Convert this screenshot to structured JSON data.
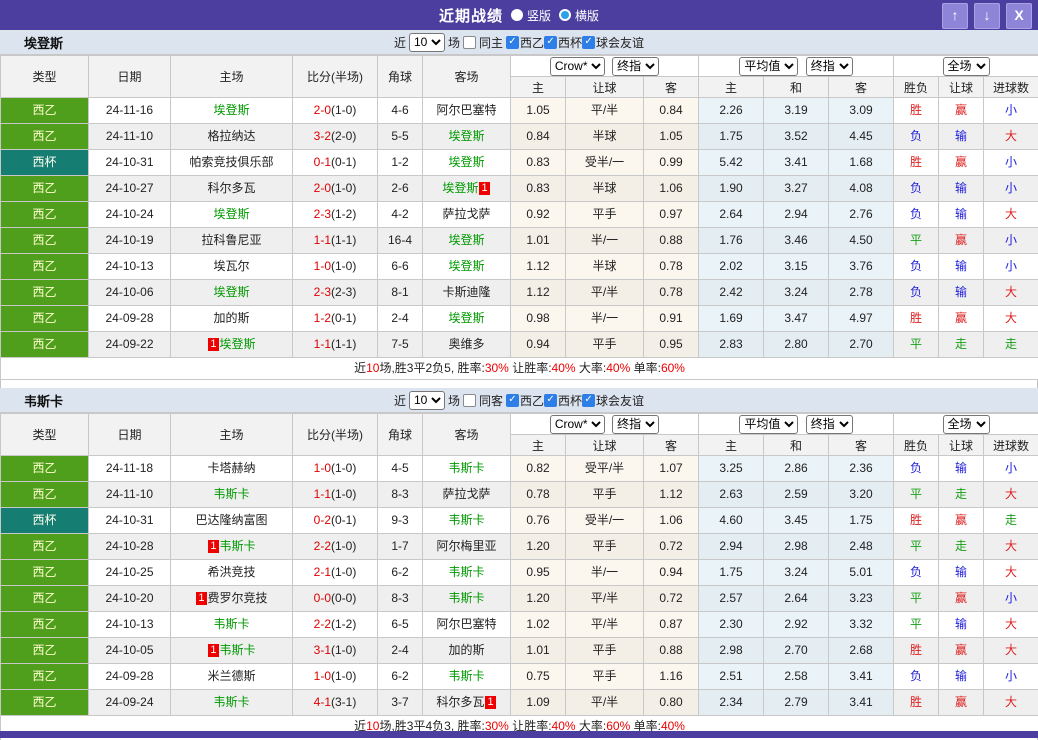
{
  "titlebar": {
    "title": "近期战绩",
    "radios": [
      {
        "label": "竖版",
        "selected": false
      },
      {
        "label": "横版",
        "selected": true
      }
    ],
    "window_buttons": [
      {
        "name": "move-up-button",
        "glyph": "↑"
      },
      {
        "name": "move-down-button",
        "glyph": "↓"
      },
      {
        "name": "close-button",
        "glyph": "X"
      }
    ]
  },
  "colors": {
    "titlebar_purple": "#4c3e9e",
    "league_green": "#4f9e1c",
    "cup_teal": "#157d72",
    "focus_team_green": "#009900",
    "score_red": "#e00000",
    "win_red": "#dd2020",
    "lose_blue": "#2020dd",
    "draw_green": "#18a018",
    "checkbox_blue": "#2d7ee6"
  },
  "columns": {
    "left": [
      "类型",
      "日期",
      "主场",
      "比分(半场)",
      "角球",
      "客场"
    ],
    "asia_selects": [
      "Crow*",
      "终指"
    ],
    "asia_sub": [
      "主",
      "让球",
      "客"
    ],
    "europe_selects": [
      "平均值",
      "终指"
    ],
    "europe_sub": [
      "主",
      "和",
      "客"
    ],
    "result_select": "全场",
    "result_sub": [
      "胜负",
      "让球",
      "进球数"
    ]
  },
  "filter_labels": {
    "near": "近",
    "matches": "10",
    "games": "场",
    "leagues": [
      "西乙",
      "西杯",
      "球会友谊"
    ]
  },
  "teams": [
    {
      "name": "埃登斯",
      "same_label": "同主",
      "same_checked": false,
      "rows": [
        {
          "type": "西乙",
          "date": "24-11-16",
          "home": {
            "name": "埃登斯",
            "focus": true
          },
          "score": "2-0",
          "half": "1-0",
          "corner": "4-6",
          "away": {
            "name": "阿尔巴塞特",
            "focus": false
          },
          "asia": [
            "1.05",
            "平/半",
            "0.84"
          ],
          "europe": [
            "2.26",
            "3.19",
            "3.09"
          ],
          "result": [
            "胜",
            "赢",
            "小"
          ]
        },
        {
          "type": "西乙",
          "date": "24-11-10",
          "home": {
            "name": "格拉纳达",
            "focus": false
          },
          "score": "3-2",
          "half": "2-0",
          "corner": "5-5",
          "away": {
            "name": "埃登斯",
            "focus": true
          },
          "asia": [
            "0.84",
            "半球",
            "1.05"
          ],
          "europe": [
            "1.75",
            "3.52",
            "4.45"
          ],
          "result": [
            "负",
            "输",
            "大"
          ]
        },
        {
          "type": "西杯",
          "date": "24-10-31",
          "home": {
            "name": "帕索竞技俱乐部",
            "focus": false
          },
          "score": "0-1",
          "half": "0-1",
          "corner": "1-2",
          "away": {
            "name": "埃登斯",
            "focus": true
          },
          "asia": [
            "0.83",
            "受半/一",
            "0.99"
          ],
          "europe": [
            "5.42",
            "3.41",
            "1.68"
          ],
          "result": [
            "胜",
            "赢",
            "小"
          ]
        },
        {
          "type": "西乙",
          "date": "24-10-27",
          "home": {
            "name": "科尔多瓦",
            "focus": false
          },
          "score": "2-0",
          "half": "1-0",
          "corner": "2-6",
          "away": {
            "name": "埃登斯",
            "focus": true,
            "badge": "right",
            "badge_text": "1"
          },
          "asia": [
            "0.83",
            "半球",
            "1.06"
          ],
          "europe": [
            "1.90",
            "3.27",
            "4.08"
          ],
          "result": [
            "负",
            "输",
            "小"
          ]
        },
        {
          "type": "西乙",
          "date": "24-10-24",
          "home": {
            "name": "埃登斯",
            "focus": true
          },
          "score": "2-3",
          "half": "1-2",
          "corner": "4-2",
          "away": {
            "name": "萨拉戈萨",
            "focus": false
          },
          "asia": [
            "0.92",
            "平手",
            "0.97"
          ],
          "europe": [
            "2.64",
            "2.94",
            "2.76"
          ],
          "result": [
            "负",
            "输",
            "大"
          ]
        },
        {
          "type": "西乙",
          "date": "24-10-19",
          "home": {
            "name": "拉科鲁尼亚",
            "focus": false
          },
          "score": "1-1",
          "half": "1-1",
          "corner": "16-4",
          "away": {
            "name": "埃登斯",
            "focus": true
          },
          "asia": [
            "1.01",
            "半/一",
            "0.88"
          ],
          "europe": [
            "1.76",
            "3.46",
            "4.50"
          ],
          "result": [
            "平",
            "赢",
            "小"
          ]
        },
        {
          "type": "西乙",
          "date": "24-10-13",
          "home": {
            "name": "埃瓦尔",
            "focus": false
          },
          "score": "1-0",
          "half": "1-0",
          "corner": "6-6",
          "away": {
            "name": "埃登斯",
            "focus": true
          },
          "asia": [
            "1.12",
            "半球",
            "0.78"
          ],
          "europe": [
            "2.02",
            "3.15",
            "3.76"
          ],
          "result": [
            "负",
            "输",
            "小"
          ]
        },
        {
          "type": "西乙",
          "date": "24-10-06",
          "home": {
            "name": "埃登斯",
            "focus": true
          },
          "score": "2-3",
          "half": "2-3",
          "corner": "8-1",
          "away": {
            "name": "卡斯迪隆",
            "focus": false
          },
          "asia": [
            "1.12",
            "平/半",
            "0.78"
          ],
          "europe": [
            "2.42",
            "3.24",
            "2.78"
          ],
          "result": [
            "负",
            "输",
            "大"
          ]
        },
        {
          "type": "西乙",
          "date": "24-09-28",
          "home": {
            "name": "加的斯",
            "focus": false
          },
          "score": "1-2",
          "half": "0-1",
          "corner": "2-4",
          "away": {
            "name": "埃登斯",
            "focus": true
          },
          "asia": [
            "0.98",
            "半/一",
            "0.91"
          ],
          "europe": [
            "1.69",
            "3.47",
            "4.97"
          ],
          "result": [
            "胜",
            "赢",
            "大"
          ]
        },
        {
          "type": "西乙",
          "date": "24-09-22",
          "home": {
            "name": "埃登斯",
            "focus": true,
            "badge": "left",
            "badge_text": "1"
          },
          "score": "1-1",
          "half": "1-1",
          "corner": "7-5",
          "away": {
            "name": "奥维多",
            "focus": false
          },
          "asia": [
            "0.94",
            "平手",
            "0.95"
          ],
          "europe": [
            "2.83",
            "2.80",
            "2.70"
          ],
          "result": [
            "平",
            "走",
            "走"
          ]
        }
      ],
      "summary": [
        {
          "text": "近",
          "red": false
        },
        {
          "text": "10",
          "red": true
        },
        {
          "text": "场,胜3平2负5, 胜率:",
          "red": false
        },
        {
          "text": "30%",
          "red": true
        },
        {
          "text": " 让胜率:",
          "red": false
        },
        {
          "text": "40%",
          "red": true
        },
        {
          "text": " 大率:",
          "red": false
        },
        {
          "text": "40%",
          "red": true
        },
        {
          "text": " 单率:",
          "red": false
        },
        {
          "text": "60%",
          "red": true
        }
      ]
    },
    {
      "name": "韦斯卡",
      "same_label": "同客",
      "same_checked": false,
      "rows": [
        {
          "type": "西乙",
          "date": "24-11-18",
          "home": {
            "name": "卡塔赫纳",
            "focus": false
          },
          "score": "1-0",
          "half": "1-0",
          "corner": "4-5",
          "away": {
            "name": "韦斯卡",
            "focus": true
          },
          "asia": [
            "0.82",
            "受平/半",
            "1.07"
          ],
          "europe": [
            "3.25",
            "2.86",
            "2.36"
          ],
          "result": [
            "负",
            "输",
            "小"
          ]
        },
        {
          "type": "西乙",
          "date": "24-11-10",
          "home": {
            "name": "韦斯卡",
            "focus": true
          },
          "score": "1-1",
          "half": "1-0",
          "corner": "8-3",
          "away": {
            "name": "萨拉戈萨",
            "focus": false
          },
          "asia": [
            "0.78",
            "平手",
            "1.12"
          ],
          "europe": [
            "2.63",
            "2.59",
            "3.20"
          ],
          "result": [
            "平",
            "走",
            "大"
          ]
        },
        {
          "type": "西杯",
          "date": "24-10-31",
          "home": {
            "name": "巴达隆纳富图",
            "focus": false
          },
          "score": "0-2",
          "half": "0-1",
          "corner": "9-3",
          "away": {
            "name": "韦斯卡",
            "focus": true
          },
          "asia": [
            "0.76",
            "受半/一",
            "1.06"
          ],
          "europe": [
            "4.60",
            "3.45",
            "1.75"
          ],
          "result": [
            "胜",
            "赢",
            "走"
          ]
        },
        {
          "type": "西乙",
          "date": "24-10-28",
          "home": {
            "name": "韦斯卡",
            "focus": true,
            "badge": "left",
            "badge_text": "1"
          },
          "score": "2-2",
          "half": "1-0",
          "corner": "1-7",
          "away": {
            "name": "阿尔梅里亚",
            "focus": false
          },
          "asia": [
            "1.20",
            "平手",
            "0.72"
          ],
          "europe": [
            "2.94",
            "2.98",
            "2.48"
          ],
          "result": [
            "平",
            "走",
            "大"
          ]
        },
        {
          "type": "西乙",
          "date": "24-10-25",
          "home": {
            "name": "希洪竞技",
            "focus": false
          },
          "score": "2-1",
          "half": "1-0",
          "corner": "6-2",
          "away": {
            "name": "韦斯卡",
            "focus": true
          },
          "asia": [
            "0.95",
            "半/一",
            "0.94"
          ],
          "europe": [
            "1.75",
            "3.24",
            "5.01"
          ],
          "result": [
            "负",
            "输",
            "大"
          ]
        },
        {
          "type": "西乙",
          "date": "24-10-20",
          "home": {
            "name": "费罗尔竞技",
            "focus": false,
            "badge": "left",
            "badge_text": "1"
          },
          "score": "0-0",
          "half": "0-0",
          "corner": "8-3",
          "away": {
            "name": "韦斯卡",
            "focus": true
          },
          "asia": [
            "1.20",
            "平/半",
            "0.72"
          ],
          "europe": [
            "2.57",
            "2.64",
            "3.23"
          ],
          "result": [
            "平",
            "赢",
            "小"
          ]
        },
        {
          "type": "西乙",
          "date": "24-10-13",
          "home": {
            "name": "韦斯卡",
            "focus": true
          },
          "score": "2-2",
          "half": "1-2",
          "corner": "6-5",
          "away": {
            "name": "阿尔巴塞特",
            "focus": false
          },
          "asia": [
            "1.02",
            "平/半",
            "0.87"
          ],
          "europe": [
            "2.30",
            "2.92",
            "3.32"
          ],
          "result": [
            "平",
            "输",
            "大"
          ]
        },
        {
          "type": "西乙",
          "date": "24-10-05",
          "home": {
            "name": "韦斯卡",
            "focus": true,
            "badge": "left",
            "badge_text": "1"
          },
          "score": "3-1",
          "half": "1-0",
          "corner": "2-4",
          "away": {
            "name": "加的斯",
            "focus": false
          },
          "asia": [
            "1.01",
            "平手",
            "0.88"
          ],
          "europe": [
            "2.98",
            "2.70",
            "2.68"
          ],
          "result": [
            "胜",
            "赢",
            "大"
          ]
        },
        {
          "type": "西乙",
          "date": "24-09-28",
          "home": {
            "name": "米兰德斯",
            "focus": false
          },
          "score": "1-0",
          "half": "1-0",
          "corner": "6-2",
          "away": {
            "name": "韦斯卡",
            "focus": true
          },
          "asia": [
            "0.75",
            "平手",
            "1.16"
          ],
          "europe": [
            "2.51",
            "2.58",
            "3.41"
          ],
          "result": [
            "负",
            "输",
            "小"
          ]
        },
        {
          "type": "西乙",
          "date": "24-09-24",
          "home": {
            "name": "韦斯卡",
            "focus": true
          },
          "score": "4-1",
          "half": "3-1",
          "corner": "3-7",
          "away": {
            "name": "科尔多瓦",
            "focus": false,
            "badge": "right",
            "badge_text": "1"
          },
          "asia": [
            "1.09",
            "平/半",
            "0.80"
          ],
          "europe": [
            "2.34",
            "2.79",
            "3.41"
          ],
          "result": [
            "胜",
            "赢",
            "大"
          ]
        }
      ],
      "summary": [
        {
          "text": "近",
          "red": false
        },
        {
          "text": "10",
          "red": true
        },
        {
          "text": "场,胜3平4负3, 胜率:",
          "red": false
        },
        {
          "text": "30%",
          "red": true
        },
        {
          "text": " 让胜率:",
          "red": false
        },
        {
          "text": "40%",
          "red": true
        },
        {
          "text": " 大率:",
          "red": false
        },
        {
          "text": "60%",
          "red": true
        },
        {
          "text": " 单率:",
          "red": false
        },
        {
          "text": "40%",
          "red": true
        }
      ]
    }
  ]
}
